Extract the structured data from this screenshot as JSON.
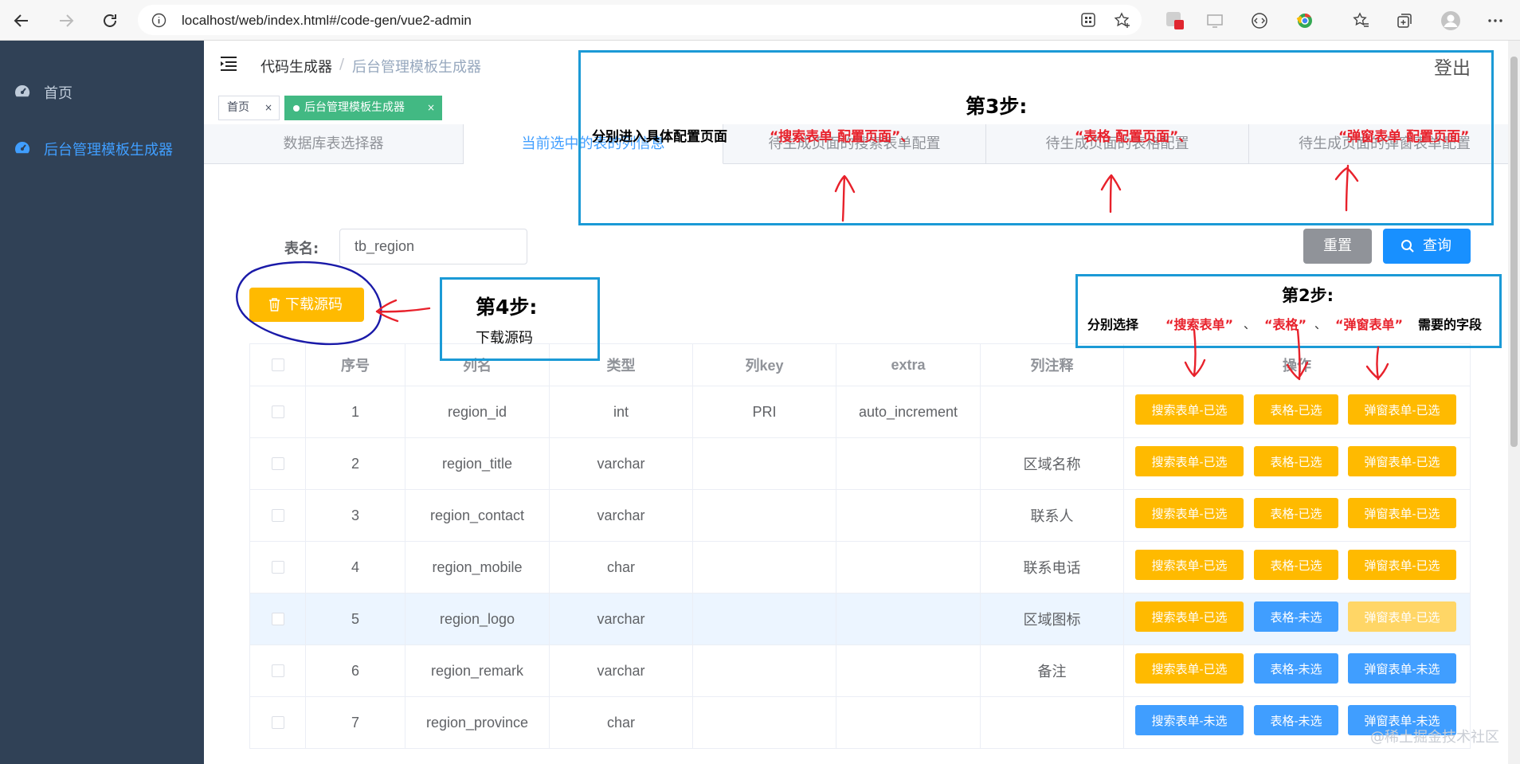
{
  "browser": {
    "url": "localhost/web/index.html#/code-gen/vue2-admin"
  },
  "sidebar": {
    "items": [
      {
        "label": "首页",
        "icon": "dashboard-icon"
      },
      {
        "label": "后台管理模板生成器",
        "icon": "dashboard-icon"
      }
    ]
  },
  "header": {
    "breadcrumb": [
      "代码生成器",
      "后台管理模板生成器"
    ],
    "breadcrumb_sep": "/",
    "logout": "登出"
  },
  "tags": [
    {
      "label": "首页",
      "close": "×"
    },
    {
      "label": "后台管理模板生成器",
      "close": "×"
    }
  ],
  "tabs": [
    "数据库表选择器",
    "当前选中的表的列信息",
    "待生成页面的搜索表单配置",
    "待生成页面的表格配置",
    "待生成页面的弹窗表单配置"
  ],
  "form": {
    "tablename_label": "表名:",
    "tablename_value": "tb_region",
    "reset": "重置",
    "query": "查询",
    "download": "下载源码"
  },
  "table": {
    "headers": [
      "序号",
      "列名",
      "类型",
      "列key",
      "extra",
      "列注释",
      "操作"
    ],
    "rows": [
      {
        "no": "1",
        "name": "region_id",
        "type": "int",
        "key": "PRI",
        "extra": "auto_increment",
        "comment": "",
        "search": "搜索表单-已选",
        "grid": "表格-已选",
        "dialog": "弹窗表单-已选"
      },
      {
        "no": "2",
        "name": "region_title",
        "type": "varchar",
        "key": "",
        "extra": "",
        "comment": "区域名称",
        "search": "搜索表单-已选",
        "grid": "表格-已选",
        "dialog": "弹窗表单-已选"
      },
      {
        "no": "3",
        "name": "region_contact",
        "type": "varchar",
        "key": "",
        "extra": "",
        "comment": "联系人",
        "search": "搜索表单-已选",
        "grid": "表格-已选",
        "dialog": "弹窗表单-已选"
      },
      {
        "no": "4",
        "name": "region_mobile",
        "type": "char",
        "key": "",
        "extra": "",
        "comment": "联系电话",
        "search": "搜索表单-已选",
        "grid": "表格-已选",
        "dialog": "弹窗表单-已选"
      },
      {
        "no": "5",
        "name": "region_logo",
        "type": "varchar",
        "key": "",
        "extra": "",
        "comment": "区域图标",
        "search": "搜索表单-已选",
        "grid": "表格-未选",
        "dialog": "弹窗表单-已选"
      },
      {
        "no": "6",
        "name": "region_remark",
        "type": "varchar",
        "key": "",
        "extra": "",
        "comment": "备注",
        "search": "搜索表单-已选",
        "grid": "表格-未选",
        "dialog": "弹窗表单-未选"
      },
      {
        "no": "7",
        "name": "region_province",
        "type": "char",
        "key": "",
        "extra": "",
        "comment": "",
        "search": "搜索表单-未选",
        "grid": "表格-未选",
        "dialog": "弹窗表单-未选"
      }
    ]
  },
  "annotations": {
    "step3_title": "第3步:",
    "step3_desc": "分别进入具体配置页面",
    "step3_search": "“搜索表单 配置页面”、",
    "step3_grid": "“表格 配置页面”、",
    "step3_dialog": "“弹窗表单 配置页面”",
    "step2_title": "第2步:",
    "step2_prefix": "分别选择",
    "step2_search": "“搜索表单”",
    "step2_sep1": "、",
    "step2_grid": "“表格”",
    "step2_sep2": "、",
    "step2_dialog": "“弹窗表单”",
    "step2_suffix": "需要的字段",
    "step4_title": "第4步:",
    "step4_desc": "下载源码"
  },
  "watermark": "@稀土掘金技术社区",
  "colors": {
    "sidebar_bg": "#304156",
    "sidebar_active": "#409eff",
    "primary": "#409eff",
    "warning": "#ffba00",
    "info": "#909399",
    "tag_active": "#42b983",
    "annotation_box": "#1b9ad6",
    "annotation_red": "#e8212b",
    "annotation_circle": "#1a1aa8"
  }
}
